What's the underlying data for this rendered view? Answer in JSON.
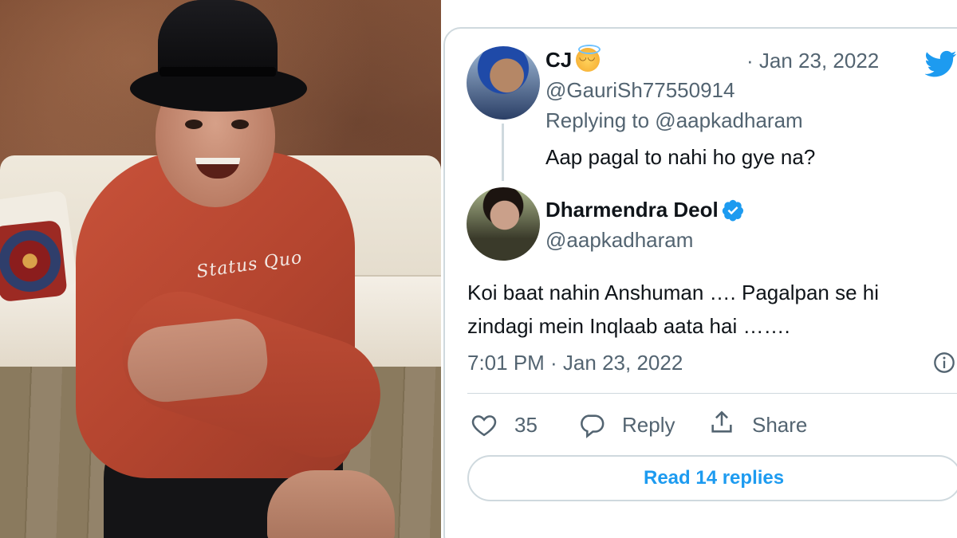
{
  "parent_tweet": {
    "display_name": "CJ",
    "name_emoji": "smiling-face-with-halo",
    "date": "· Jan 23, 2022",
    "handle": "@GauriSh77550914",
    "replying_to": "Replying to @aapkadharam",
    "text": "Aap pagal to nahi ho gye na?"
  },
  "reply_tweet": {
    "display_name": "Dharmendra Deol",
    "verified": true,
    "handle": "@aapkadharam",
    "text_line1": "Koi baat nahin Anshuman …. Pagalpan se hi",
    "text_line2": "zindagi mein Inqlaab aata hai …….",
    "timestamp": "7:01 PM · Jan 23, 2022"
  },
  "actions": {
    "like_count": "35",
    "reply_label": "Reply",
    "share_label": "Share"
  },
  "read_replies_label": "Read 14 replies",
  "photo": {
    "shirt_print": "Status Quo"
  },
  "colors": {
    "twitter_blue": "#1d9bf0",
    "secondary_text": "#536471",
    "border": "#cfd9de"
  },
  "icons": [
    "twitter-bird-icon",
    "verified-badge-icon",
    "info-icon",
    "heart-icon",
    "reply-icon",
    "share-icon"
  ]
}
